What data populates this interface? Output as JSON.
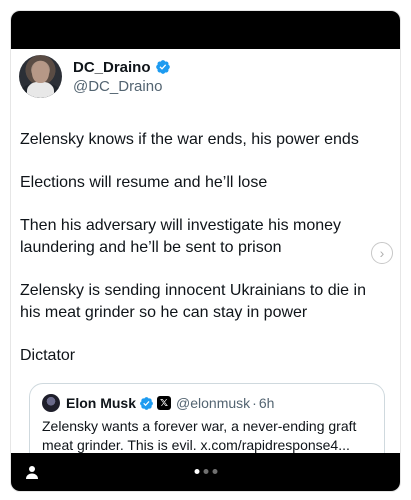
{
  "author": {
    "display_name": "DC_Draino",
    "handle": "@DC_Draino",
    "verified_icon": "verified-badge-icon"
  },
  "tweet": {
    "paragraphs": [
      "Zelensky knows if the war ends, his power ends",
      "Elections will resume and he’ll lose",
      "Then his adversary will investigate his money laundering and he’ll be sent to prison",
      "Zelensky is sending innocent Ukrainians to die in his meat grinder so he can stay in power",
      "Dictator"
    ]
  },
  "quote": {
    "display_name": "Elon Musk",
    "badge": "𝕏",
    "handle": "@elonmusk",
    "separator": "·",
    "time": "6h",
    "text": "Zelensky wants a forever war, a never-ending graft meat grinder. This is evil. x.com/rapidresponse4..."
  },
  "carousel": {
    "chevron": "›",
    "page_count": 3,
    "active_index": 0
  },
  "colors": {
    "verified_blue": "#1d9bf0",
    "text": "#0f1419",
    "muted": "#536471",
    "bar": "#000000"
  }
}
